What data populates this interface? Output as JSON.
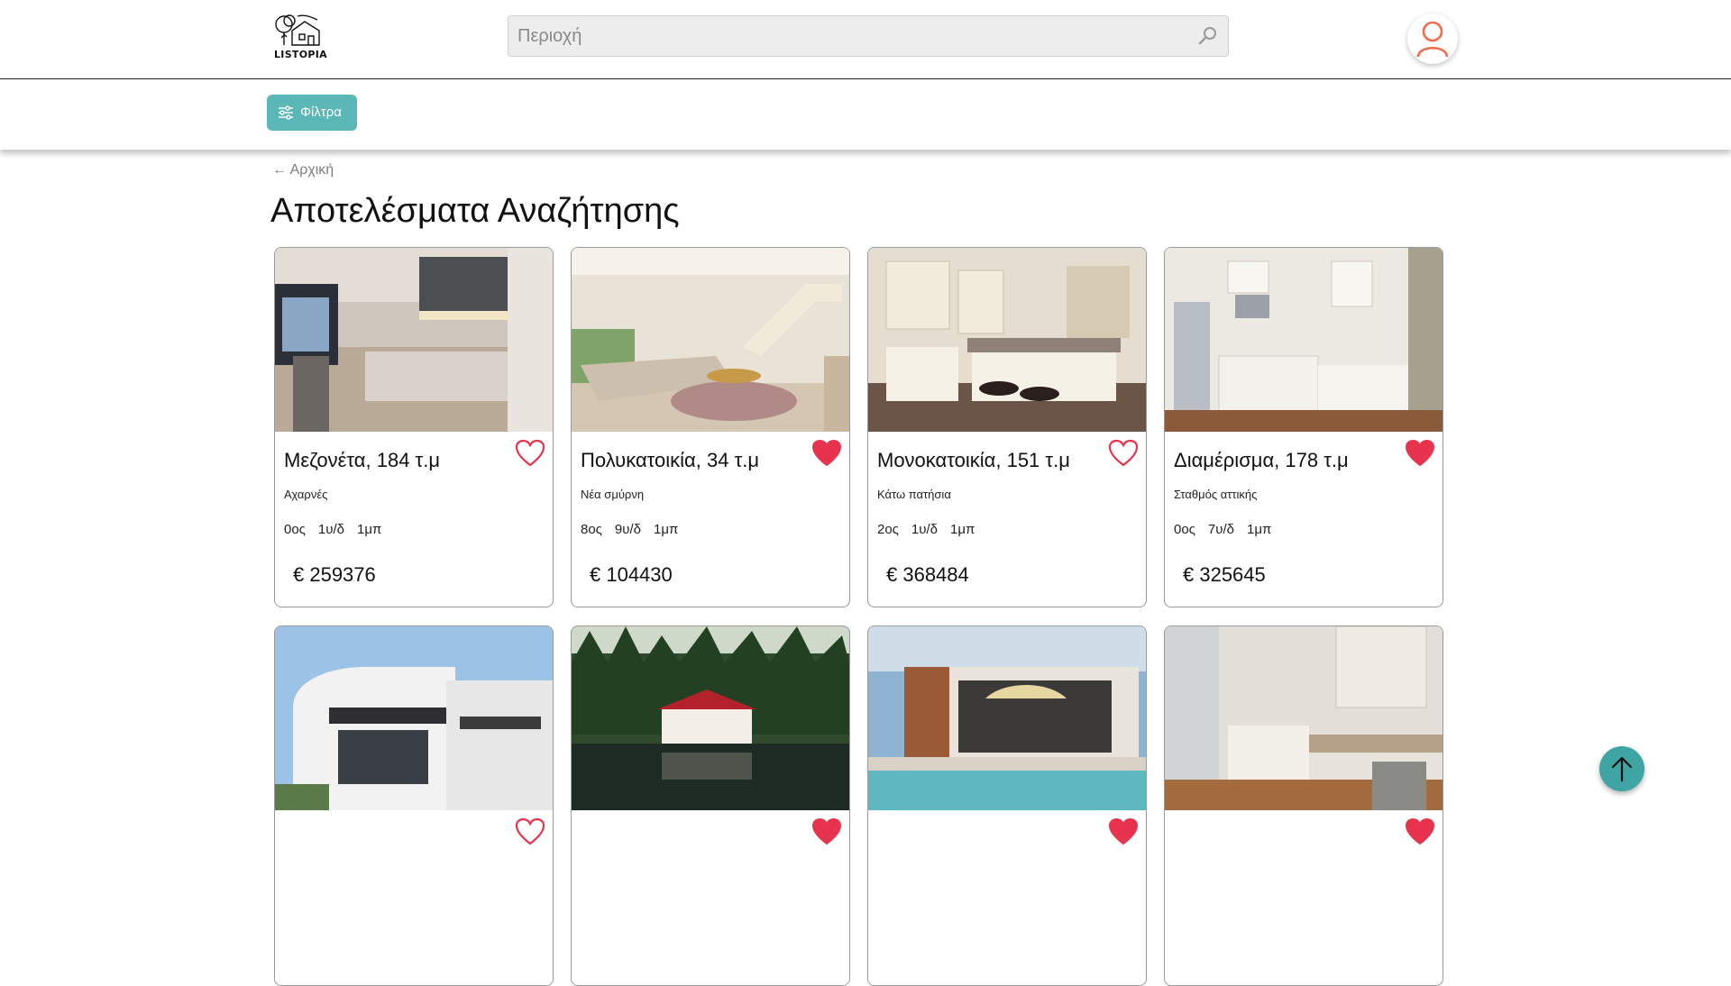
{
  "header": {
    "logo_text": "LISTOPIA",
    "search_placeholder": "Περιοχή"
  },
  "toolbar": {
    "filter_label": "Φίλτρα"
  },
  "breadcrumb": {
    "back_label": "← Αρχική"
  },
  "page": {
    "title": "Αποτελέσματα Αναζήτησης"
  },
  "colors": {
    "accent": "#5bb6b6",
    "heart": "#e8334f",
    "avatar": "#f06d4f"
  },
  "listings": [
    {
      "title": "Μεζονέτα, 184 τ.μ",
      "area": "Αχαρνές",
      "floor": "0ος",
      "rooms": "1υ/δ",
      "baths": "1μπ",
      "price": "€ 259376",
      "favorite": false,
      "image": "modern-kitchen-grey"
    },
    {
      "title": "Πολυκατοικία, 34 τ.μ",
      "area": "Νέα σμύρνη",
      "floor": "8ος",
      "rooms": "9υ/δ",
      "baths": "1μπ",
      "price": "€ 104430",
      "favorite": true,
      "image": "living-room-stairs"
    },
    {
      "title": "Μονοκατοικία, 151 τ.μ",
      "area": "Κάτω πατήσια",
      "floor": "2ος",
      "rooms": "1υ/δ",
      "baths": "1μπ",
      "price": "€ 368484",
      "favorite": false,
      "image": "kitchen-island"
    },
    {
      "title": "Διαμέρισμα, 178 τ.μ",
      "area": "Σταθμός αττικής",
      "floor": "0ος",
      "rooms": "7υ/δ",
      "baths": "1μπ",
      "price": "€ 325645",
      "favorite": true,
      "image": "small-kitchen"
    },
    {
      "title": "",
      "area": "",
      "floor": "",
      "rooms": "",
      "baths": "",
      "price": "",
      "favorite": false,
      "image": "modern-house-exterior"
    },
    {
      "title": "",
      "area": "",
      "floor": "",
      "rooms": "",
      "baths": "",
      "price": "",
      "favorite": true,
      "image": "lake-house-forest"
    },
    {
      "title": "",
      "area": "",
      "floor": "",
      "rooms": "",
      "baths": "",
      "price": "",
      "favorite": true,
      "image": "pool-house"
    },
    {
      "title": "",
      "area": "",
      "floor": "",
      "rooms": "",
      "baths": "",
      "price": "",
      "favorite": true,
      "image": "wood-floor-kitchen"
    }
  ]
}
